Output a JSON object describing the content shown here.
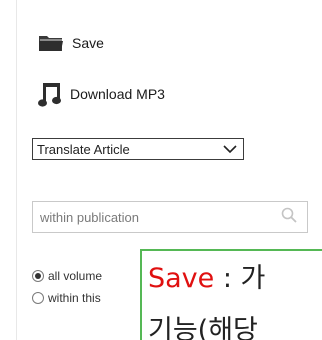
{
  "tools": {
    "save_label": "Save",
    "download_mp3_label": "Download MP3",
    "save_icon": "folder-icon",
    "download_mp3_icon": "music-note-icon"
  },
  "translate": {
    "selected": "Translate Article"
  },
  "search": {
    "placeholder": "within publication"
  },
  "scope": {
    "options": [
      {
        "label": "all volume",
        "checked": true
      },
      {
        "label": "within this",
        "checked": false
      }
    ]
  },
  "tooltip": {
    "keyword": "Save",
    "separator": " : ",
    "text_line1": "가",
    "text_line2": "기능(해당"
  },
  "colors": {
    "tooltip_border": "#55b855",
    "tooltip_keyword": "#e01010",
    "icon": "#333333"
  }
}
